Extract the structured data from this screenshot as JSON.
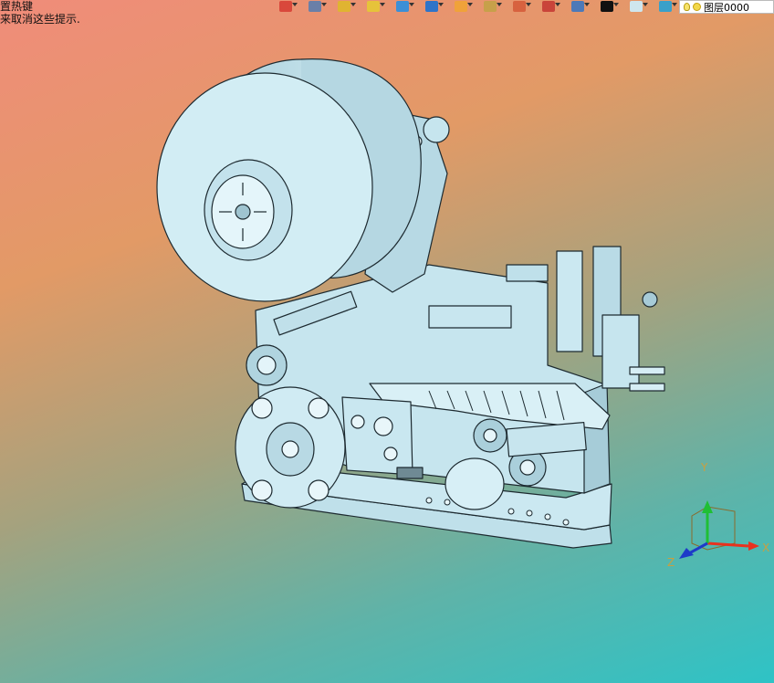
{
  "hint": {
    "line1": "置热键",
    "line2": "来取消这些提示."
  },
  "toolbar": {
    "buttons": [
      {
        "icon": "exit-icon",
        "color": "#d9483b"
      },
      {
        "icon": "style-icon",
        "color": "#6a7fa8"
      },
      {
        "icon": "pencil-icon",
        "color": "#e0b431"
      },
      {
        "icon": "box-icon",
        "color": "#e6c33a"
      },
      {
        "icon": "cube-icon",
        "color": "#3d8fd6"
      },
      {
        "icon": "view-cube-icon",
        "color": "#2f74c8"
      },
      {
        "icon": "snap-icon",
        "color": "#f0a23a"
      },
      {
        "icon": "render-icon",
        "color": "#c7a04a"
      },
      {
        "icon": "page-icon",
        "color": "#d7623f"
      },
      {
        "icon": "save-view-icon",
        "color": "#c9443a"
      },
      {
        "icon": "display-icon",
        "color": "#4d79b8"
      },
      {
        "icon": "line-color-icon",
        "color": "#111111"
      },
      {
        "icon": "fill-icon",
        "color": "#cfe6ee"
      },
      {
        "icon": "layers-icon",
        "color": "#3aa0c9"
      }
    ],
    "layer_label": "图层0000"
  },
  "axes": {
    "x_label": "X",
    "y_label": "Y",
    "z_label": "Z",
    "x_color": "#e8321e",
    "y_color": "#1fbf34",
    "z_color": "#1d3ac9"
  },
  "colors": {
    "model_fill": "#c4e4ee",
    "model_shade": "#9bc3d0",
    "model_edge": "#1d2a30"
  }
}
